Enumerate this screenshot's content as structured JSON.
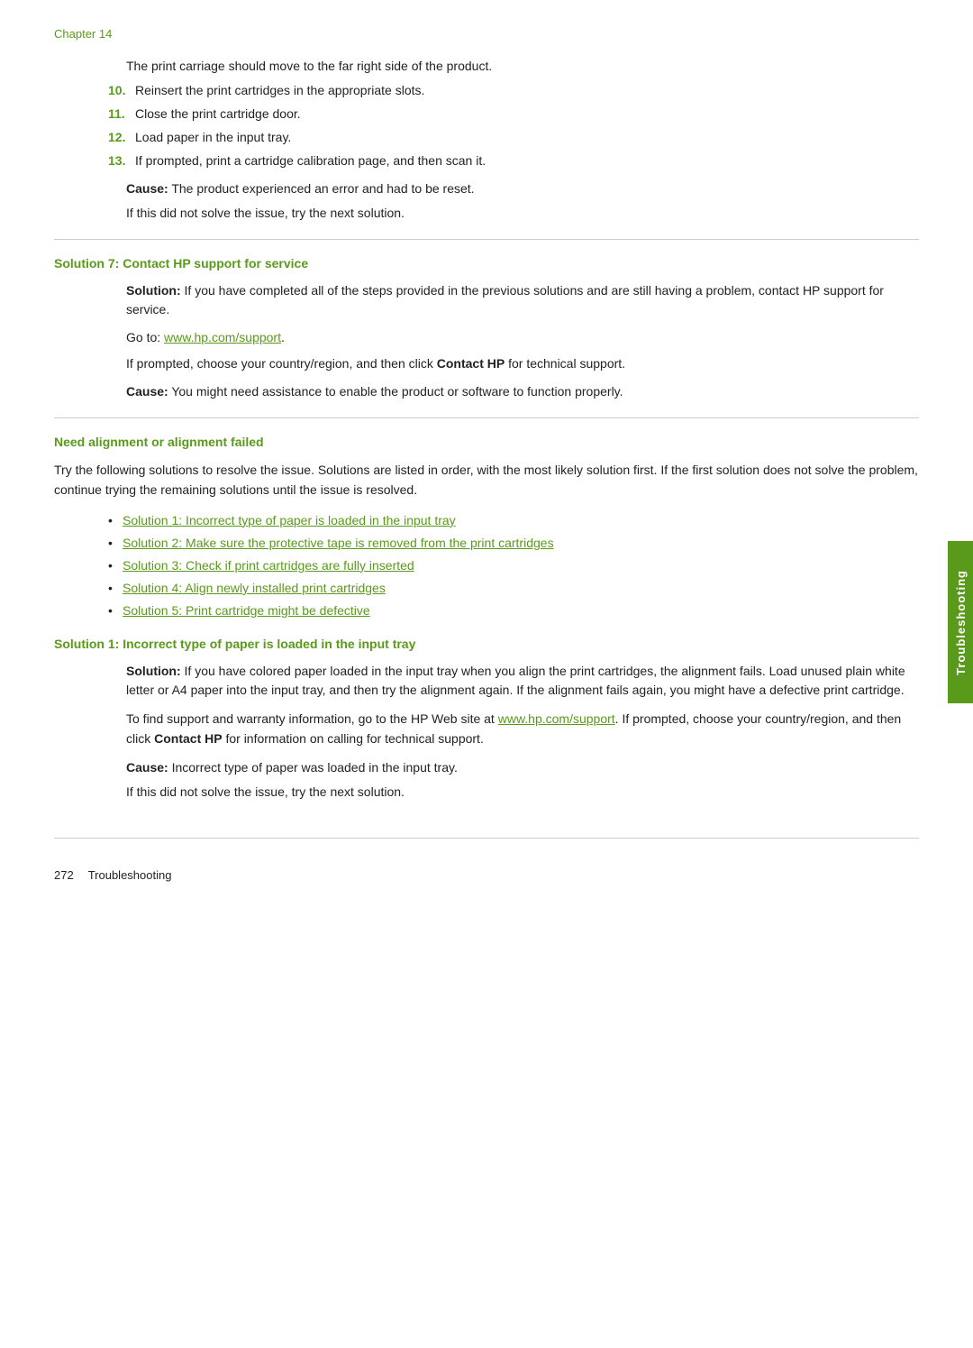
{
  "chapter": {
    "label": "Chapter 14"
  },
  "intro": {
    "line1": "The print carriage should move to the far right side of the product.",
    "steps": [
      {
        "num": "10.",
        "text": "Reinsert the print cartridges in the appropriate slots."
      },
      {
        "num": "11.",
        "text": "Close the print cartridge door."
      },
      {
        "num": "12.",
        "text": "Load paper in the input tray."
      },
      {
        "num": "13.",
        "text": "If prompted, print a cartridge calibration page, and then scan it."
      }
    ],
    "cause_label": "Cause:",
    "cause_text": "   The product experienced an error and had to be reset.",
    "if_not_solved": "If this did not solve the issue, try the next solution."
  },
  "solution7": {
    "heading": "Solution 7: Contact HP support for service",
    "solution_label": "Solution:",
    "solution_text": "  If you have completed all of the steps provided in the previous solutions and are still having a problem, contact HP support for service.",
    "goto_prefix": "Go to: ",
    "goto_link": "www.hp.com/support",
    "goto_url": "http://www.hp.com/support",
    "if_prompted": "If prompted, choose your country/region, and then click ",
    "contact_hp_bold": "Contact HP",
    "if_prompted_suffix": " for technical support.",
    "cause_label": "Cause:",
    "cause_text": "   You might need assistance to enable the product or software to function properly."
  },
  "need_alignment": {
    "heading": "Need alignment or alignment failed",
    "intro": "Try the following solutions to resolve the issue. Solutions are listed in order, with the most likely solution first. If the first solution does not solve the problem, continue trying the remaining solutions until the issue is resolved.",
    "bullets": [
      {
        "text": "Solution 1: Incorrect type of paper is loaded in the input tray"
      },
      {
        "text": "Solution 2: Make sure the protective tape is removed from the print cartridges"
      },
      {
        "text": "Solution 3: Check if print cartridges are fully inserted"
      },
      {
        "text": "Solution 4: Align newly installed print cartridges"
      },
      {
        "text": "Solution 5: Print cartridge might be defective"
      }
    ]
  },
  "solution1": {
    "heading": "Solution 1: Incorrect type of paper is loaded in the input tray",
    "solution_label": "Solution:",
    "solution_text": "  If you have colored paper loaded in the input tray when you align the print cartridges, the alignment fails. Load unused plain white letter or A4 paper into the input tray, and then try the alignment again. If the alignment fails again, you might have a defective print cartridge.",
    "para2_prefix": "To find support and warranty information, go to the HP Web site at ",
    "link1": "www.hp.com/support",
    "link1_url": "http://www.hp.com/support",
    "para2_mid": ". If prompted, choose your country/region, and then click ",
    "contact_hp_bold": "Contact HP",
    "para2_suffix": " for information on calling for technical support.",
    "cause_label": "Cause:",
    "cause_text": "   Incorrect type of paper was loaded in the input tray.",
    "if_not_solved": "If this did not solve the issue, try the next solution."
  },
  "side_tab": {
    "label": "Troubleshooting"
  },
  "footer": {
    "page_number": "272",
    "label": "Troubleshooting"
  }
}
